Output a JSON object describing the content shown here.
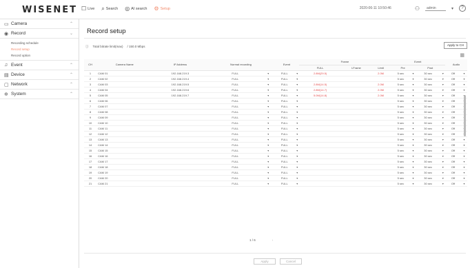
{
  "header": {
    "logo": "WISENET",
    "nav": [
      {
        "glyph": "☐",
        "label": "Live"
      },
      {
        "glyph": "⌕",
        "label": "Search"
      },
      {
        "glyph": "◎",
        "label": "AI search"
      },
      {
        "glyph": "⚙",
        "label": "Setup"
      }
    ],
    "datetime": "2020-06-11 10:50:46",
    "user": "admin",
    "help": "?"
  },
  "sidebar": {
    "camera": {
      "icon": "camera-icon",
      "glyph": "▭",
      "label": "Camera"
    },
    "record": {
      "icon": "record-icon",
      "glyph": "◉",
      "label": "Record"
    },
    "record_sub": [
      "Recording schedule",
      "Record setup",
      "Record option"
    ],
    "event": {
      "icon": "bell-icon",
      "glyph": "♫",
      "label": "Event"
    },
    "device": {
      "icon": "device-icon",
      "glyph": "▤",
      "label": "Device"
    },
    "network": {
      "icon": "network-icon",
      "glyph": "▢",
      "label": "Network"
    },
    "system": {
      "icon": "gear-icon",
      "glyph": "✲",
      "label": "System"
    }
  },
  "main": {
    "title": "Record setup",
    "bitrate_label": "Total bitrate limit(max)",
    "bitrate_value": "/ 150.0 Mbps",
    "apply_button": "Apply to CH",
    "page": "1 / 6",
    "footer_apply": "Apply",
    "footer_cancel": "Cancel"
  },
  "columns": {
    "ch": "CH",
    "camera": "Camera Name",
    "ip": "IP Address",
    "normal": "Normal recording",
    "event": "Event",
    "frame": "Frame",
    "full": "FULL",
    "iframe": "I-Frame",
    "limit": "Limit",
    "event_group": "Event",
    "pre": "Pre",
    "post": "Post",
    "audio": "Audio"
  },
  "rows": [
    {
      "ch": "1",
      "cam": "CAM 01",
      "ip": "192.168.219.3",
      "normal": "FULL",
      "event": "FULL",
      "full": "2.8M(29.5)",
      "limit": "2.0M",
      "pre": "5 sec",
      "post": "30 sec",
      "audio": "Off"
    },
    {
      "ch": "2",
      "cam": "CAM 02",
      "ip": "192.168.219.4",
      "normal": "FULL",
      "event": "FULL",
      "full": "",
      "limit": "",
      "pre": "5 sec",
      "post": "30 sec",
      "audio": "Off"
    },
    {
      "ch": "3",
      "cam": "CAM 03",
      "ip": "192.168.219.5",
      "normal": "FULL",
      "event": "FULL",
      "full": "2.8M(14.5)",
      "limit": "2.0M",
      "pre": "5 sec",
      "post": "30 sec",
      "audio": "Off"
    },
    {
      "ch": "4",
      "cam": "CAM 04",
      "ip": "192.168.219.6",
      "normal": "FULL",
      "event": "FULL",
      "full": "2.8M(14.7)",
      "limit": "2.0M",
      "pre": "5 sec",
      "post": "30 sec",
      "audio": "Off"
    },
    {
      "ch": "5",
      "cam": "CAM 05",
      "ip": "192.168.219.7",
      "normal": "FULL",
      "event": "FULL",
      "full": "5.0M(14.8)",
      "limit": "2.0M",
      "pre": "5 sec",
      "post": "30 sec",
      "audio": "Off"
    },
    {
      "ch": "6",
      "cam": "CAM 06",
      "ip": "",
      "normal": "FULL",
      "event": "FULL",
      "full": "",
      "limit": "",
      "pre": "5 sec",
      "post": "30 sec",
      "audio": "Off"
    },
    {
      "ch": "7",
      "cam": "CAM 07",
      "ip": "",
      "normal": "FULL",
      "event": "FULL",
      "full": "",
      "limit": "",
      "pre": "5 sec",
      "post": "30 sec",
      "audio": "Off"
    },
    {
      "ch": "8",
      "cam": "CAM 08",
      "ip": "",
      "normal": "FULL",
      "event": "FULL",
      "full": "",
      "limit": "",
      "pre": "5 sec",
      "post": "30 sec",
      "audio": "Off"
    },
    {
      "ch": "9",
      "cam": "CAM 09",
      "ip": "",
      "normal": "FULL",
      "event": "FULL",
      "full": "",
      "limit": "",
      "pre": "5 sec",
      "post": "30 sec",
      "audio": "Off"
    },
    {
      "ch": "10",
      "cam": "CAM 10",
      "ip": "",
      "normal": "FULL",
      "event": "FULL",
      "full": "",
      "limit": "",
      "pre": "5 sec",
      "post": "30 sec",
      "audio": "Off"
    },
    {
      "ch": "11",
      "cam": "CAM 11",
      "ip": "",
      "normal": "FULL",
      "event": "FULL",
      "full": "",
      "limit": "",
      "pre": "5 sec",
      "post": "30 sec",
      "audio": "Off"
    },
    {
      "ch": "12",
      "cam": "CAM 12",
      "ip": "",
      "normal": "FULL",
      "event": "FULL",
      "full": "",
      "limit": "",
      "pre": "5 sec",
      "post": "30 sec",
      "audio": "Off"
    },
    {
      "ch": "13",
      "cam": "CAM 13",
      "ip": "",
      "normal": "FULL",
      "event": "FULL",
      "full": "",
      "limit": "",
      "pre": "5 sec",
      "post": "30 sec",
      "audio": "Off"
    },
    {
      "ch": "14",
      "cam": "CAM 14",
      "ip": "",
      "normal": "FULL",
      "event": "FULL",
      "full": "",
      "limit": "",
      "pre": "5 sec",
      "post": "30 sec",
      "audio": "Off"
    },
    {
      "ch": "15",
      "cam": "CAM 15",
      "ip": "",
      "normal": "FULL",
      "event": "FULL",
      "full": "",
      "limit": "",
      "pre": "5 sec",
      "post": "30 sec",
      "audio": "Off"
    },
    {
      "ch": "16",
      "cam": "CAM 16",
      "ip": "",
      "normal": "FULL",
      "event": "FULL",
      "full": "",
      "limit": "",
      "pre": "5 sec",
      "post": "30 sec",
      "audio": "Off"
    },
    {
      "ch": "17",
      "cam": "CAM 17",
      "ip": "",
      "normal": "FULL",
      "event": "FULL",
      "full": "",
      "limit": "",
      "pre": "5 sec",
      "post": "30 sec",
      "audio": "Off"
    },
    {
      "ch": "18",
      "cam": "CAM 18",
      "ip": "",
      "normal": "FULL",
      "event": "FULL",
      "full": "",
      "limit": "",
      "pre": "5 sec",
      "post": "30 sec",
      "audio": "Off"
    },
    {
      "ch": "19",
      "cam": "CAM 19",
      "ip": "",
      "normal": "FULL",
      "event": "FULL",
      "full": "",
      "limit": "",
      "pre": "5 sec",
      "post": "30 sec",
      "audio": "Off"
    },
    {
      "ch": "20",
      "cam": "CAM 20",
      "ip": "",
      "normal": "FULL",
      "event": "FULL",
      "full": "",
      "limit": "",
      "pre": "5 sec",
      "post": "30 sec",
      "audio": "Off"
    },
    {
      "ch": "21",
      "cam": "CAM 21",
      "ip": "",
      "normal": "FULL",
      "event": "FULL",
      "full": "",
      "limit": "",
      "pre": "5 sec",
      "post": "30 sec",
      "audio": "Off"
    }
  ],
  "colors": {
    "accent": "#f28a6b",
    "limit_red": "#e24a4a"
  }
}
